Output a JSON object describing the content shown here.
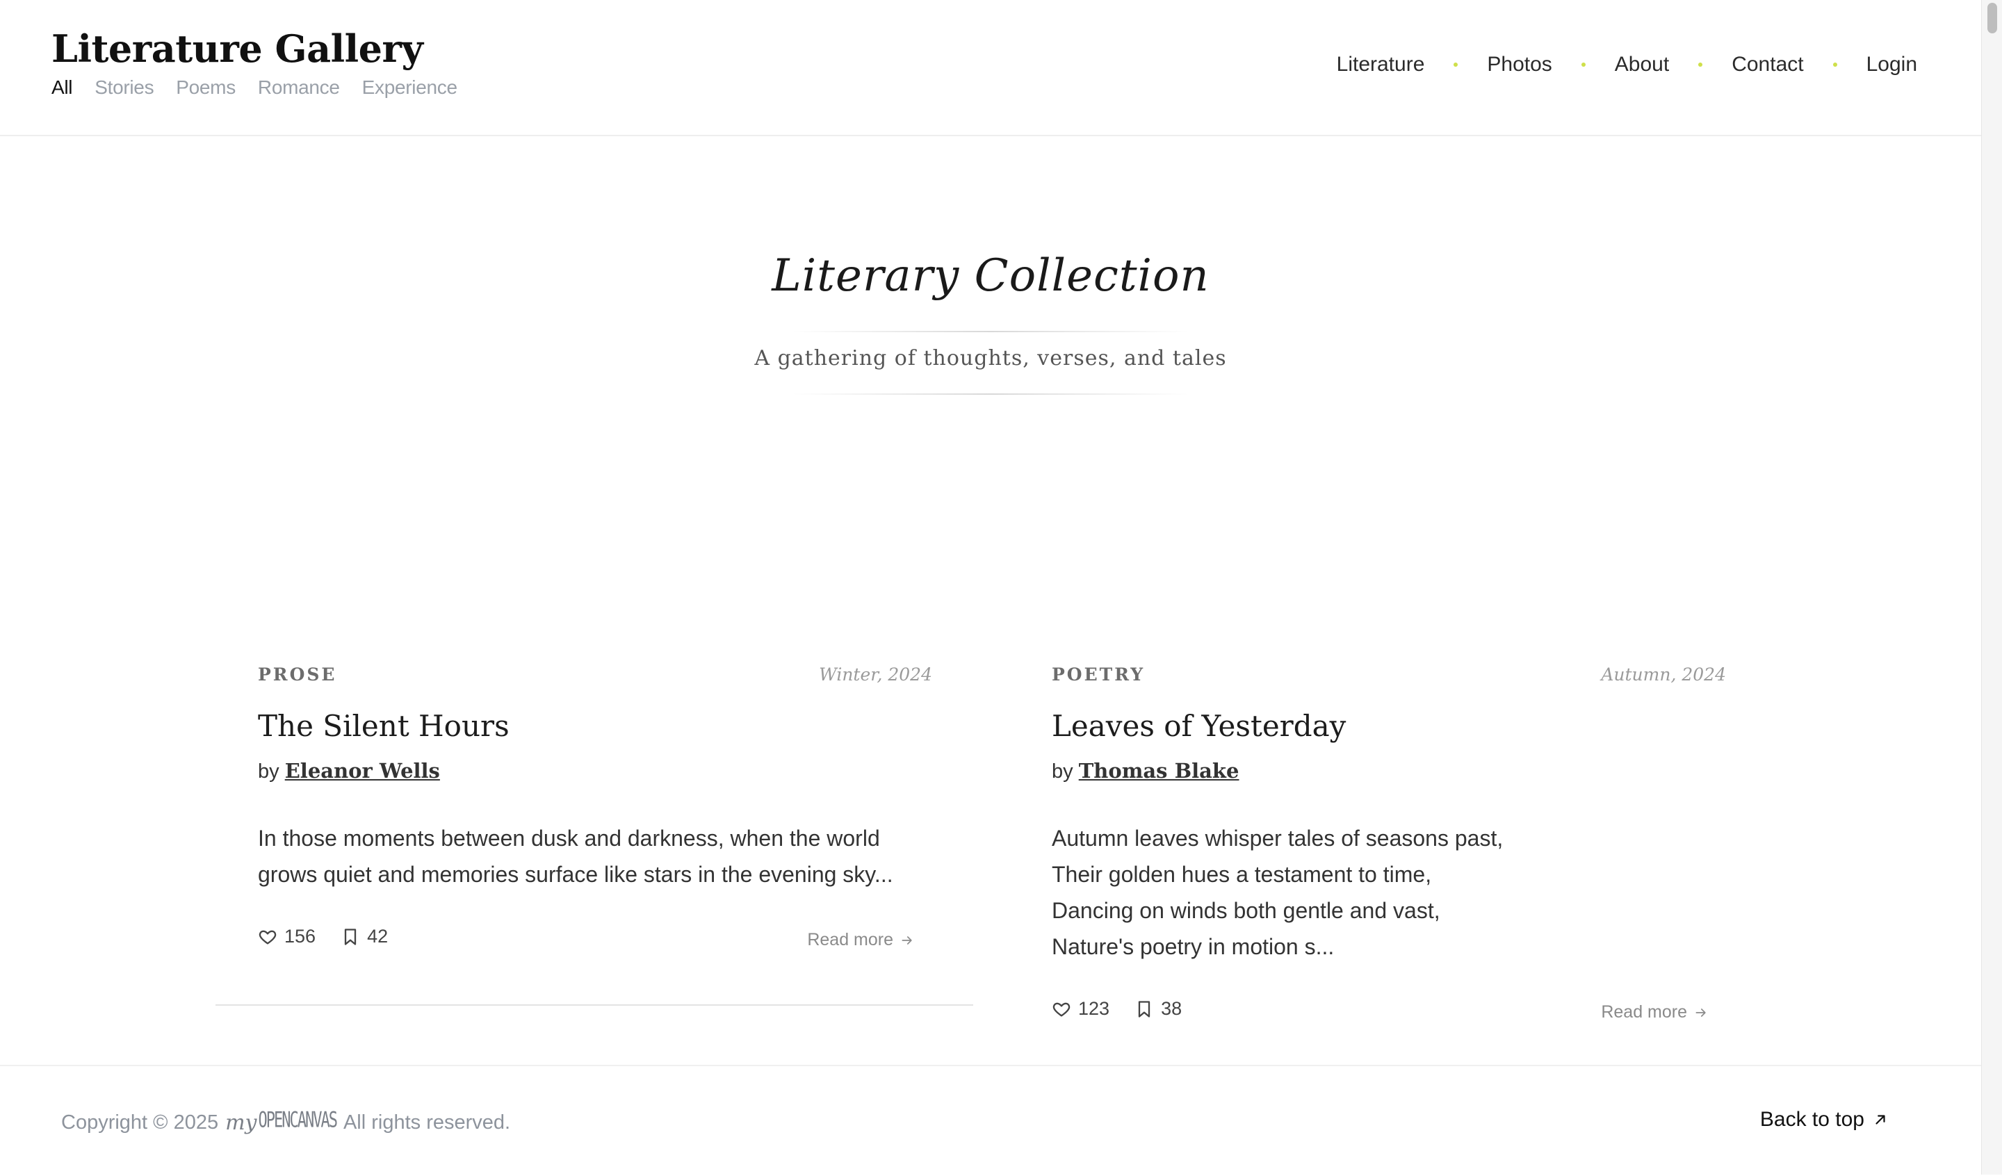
{
  "header": {
    "logo": "Literature Gallery",
    "filters": [
      {
        "label": "All",
        "active": true
      },
      {
        "label": "Stories",
        "active": false
      },
      {
        "label": "Poems",
        "active": false
      },
      {
        "label": "Romance",
        "active": false
      },
      {
        "label": "Experience",
        "active": false
      }
    ],
    "nav": [
      "Literature",
      "Photos",
      "About",
      "Contact",
      "Login"
    ]
  },
  "hero": {
    "title": "Literary Collection",
    "subtitle": "A gathering of thoughts, verses, and tales"
  },
  "cards": [
    {
      "category": "PROSE",
      "date": "Winter, 2024",
      "title": "The Silent Hours",
      "by": "by",
      "author": "Eleanor Wells",
      "excerpt": [
        "In those moments between dusk and darkness, when the world",
        "grows quiet and memories surface like stars in the evening sky..."
      ],
      "likes": "156",
      "bookmarks": "42",
      "read_more": "Read more",
      "like_icon": "heart-icon",
      "bookmark_icon": "bookmark-icon",
      "arrow_icon": "arrow-right-icon"
    },
    {
      "category": "POETRY",
      "date": "Autumn, 2024",
      "title": "Leaves of Yesterday",
      "by": "by",
      "author": "Thomas Blake",
      "excerpt": [
        "Autumn leaves whisper tales of seasons past,",
        "Their golden hues a testament to time,",
        "Dancing on winds both gentle and vast,",
        "Nature's poetry in motion s..."
      ],
      "likes": "123",
      "bookmarks": "38",
      "read_more": "Read more",
      "like_icon": "heart-icon",
      "bookmark_icon": "bookmark-icon",
      "arrow_icon": "arrow-right-icon"
    }
  ],
  "footer": {
    "copyright": "Copyright © 2025",
    "brand_my": "my",
    "brand_name": "OPENCANVAS",
    "rights": "All rights reserved.",
    "back_to_top": "Back to top",
    "back_icon": "arrow-up-right-icon"
  },
  "colors": {
    "accent_dot": "#cfe04a",
    "muted_text": "#9aa0a8",
    "text": "#1f1f1f"
  }
}
